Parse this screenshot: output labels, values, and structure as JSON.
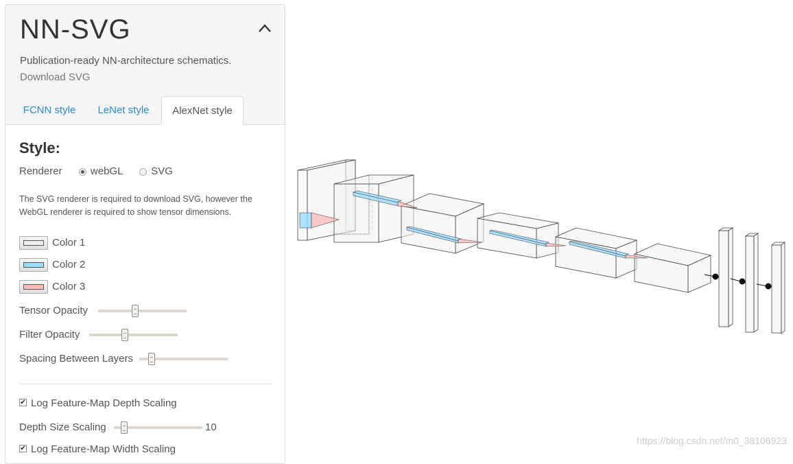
{
  "app": {
    "title": "NN-SVG",
    "subtitle": "Publication-ready NN-architecture schematics.",
    "download": "Download SVG"
  },
  "tabs": [
    {
      "label": "FCNN style",
      "active": false
    },
    {
      "label": "LeNet style",
      "active": false
    },
    {
      "label": "AlexNet style",
      "active": true
    }
  ],
  "style": {
    "heading": "Style:",
    "renderer_label": "Renderer",
    "renderer_options": [
      "webGL",
      "SVG"
    ],
    "renderer_selected": "webGL",
    "note": "The SVG renderer is required to download SVG, however the WebGL renderer is required to show tensor dimensions."
  },
  "colors": [
    {
      "label": "Color 1",
      "value": "#eeeeee"
    },
    {
      "label": "Color 2",
      "value": "#99ddff"
    },
    {
      "label": "Color 3",
      "value": "#ffbbbb"
    }
  ],
  "sliders": [
    {
      "label": "Tensor Opacity",
      "fraction": 0.42
    },
    {
      "label": "Filter Opacity",
      "fraction": 0.4
    },
    {
      "label": "Spacing Between Layers",
      "fraction": 0.14
    }
  ],
  "options": {
    "log_depth": {
      "label": "Log Feature-Map Depth Scaling",
      "checked": true
    },
    "depth_scaling": {
      "label": "Depth Size Scaling",
      "value": "10",
      "fraction": 0.12
    },
    "log_width": {
      "label": "Log Feature-Map Width Scaling",
      "checked": true
    }
  },
  "watermark": "https://blog.csdn.net/m0_38106923"
}
